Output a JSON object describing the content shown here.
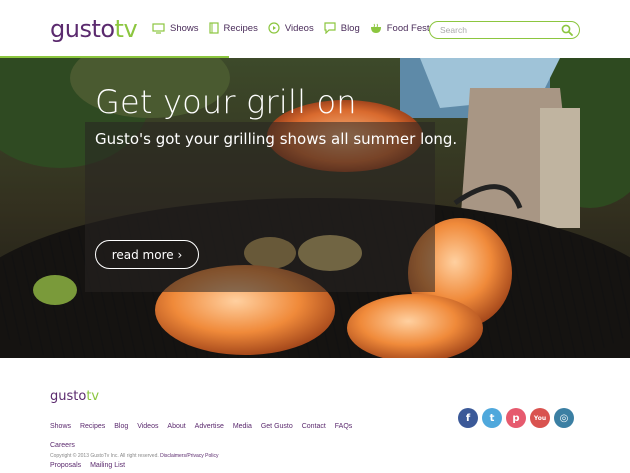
{
  "brand": {
    "name_main": "gusto",
    "name_accent": "tv"
  },
  "nav": [
    {
      "label": "Shows",
      "icon": "tv-icon"
    },
    {
      "label": "Recipes",
      "icon": "recipe-book-icon"
    },
    {
      "label": "Videos",
      "icon": "play-icon"
    },
    {
      "label": "Blog",
      "icon": "speech-bubble-icon"
    },
    {
      "label": "Food Fests",
      "icon": "bowl-icon"
    }
  ],
  "search": {
    "placeholder": "Search"
  },
  "hero": {
    "title": "Get your grill on",
    "subtitle": "Gusto's got your grilling shows all summer long.",
    "button": "read more ›"
  },
  "footer": {
    "links_row1": [
      "Shows",
      "Recipes",
      "Blog",
      "Videos",
      "About",
      "Advertise",
      "Media",
      "Get Gusto",
      "Contact",
      "FAQs",
      "Careers"
    ],
    "links_row2": [
      "Proposals",
      "Mailing List"
    ],
    "copyright": "Copyright © 2013 GustoTv Inc. All right reserved.",
    "policy": "Disclaimers/Privacy Policy"
  },
  "social": [
    {
      "icon": "facebook-icon",
      "glyph": "f",
      "color": "#3b5998"
    },
    {
      "icon": "twitter-icon",
      "glyph": "t",
      "color": "#4fa8dc"
    },
    {
      "icon": "pinterest-icon",
      "glyph": "p",
      "color": "#e65a6e"
    },
    {
      "icon": "youtube-icon",
      "glyph": "You",
      "color": "#d9534f"
    },
    {
      "icon": "instagram-icon",
      "glyph": "◎",
      "color": "#3b7fa3"
    }
  ],
  "colors": {
    "purple": "#5b2a6e",
    "green": "#8cc63f"
  }
}
